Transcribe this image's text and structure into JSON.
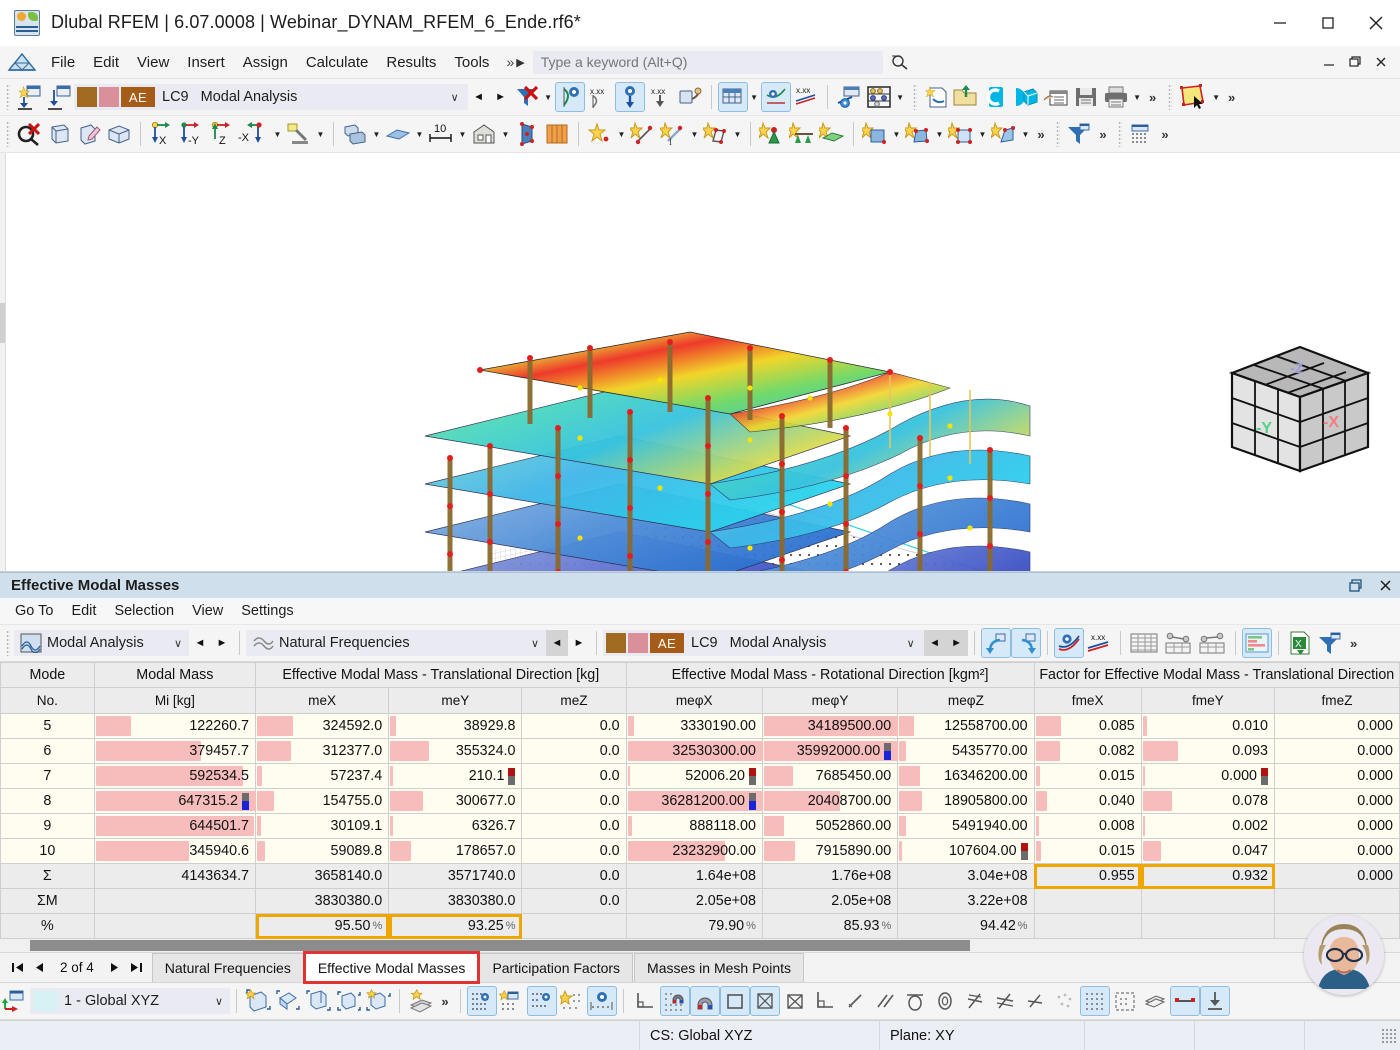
{
  "window": {
    "title": "Dlubal RFEM | 6.07.0008 | Webinar_DYNAM_RFEM_6_Ende.rf6*",
    "app_icon": "dlubal-logo-icon",
    "minimize": "minimize-icon",
    "maximize": "maximize-icon",
    "close": "close-icon"
  },
  "menu": {
    "items": [
      "File",
      "Edit",
      "View",
      "Insert",
      "Assign",
      "Calculate",
      "Results",
      "Tools"
    ],
    "overflow": "»",
    "play": "▶",
    "search_placeholder": "Type a keyword (Alt+Q)",
    "search_value": "",
    "search_icon": "search-icon"
  },
  "toolbar_loadcase": {
    "swatch_a": "#a06a20",
    "swatch_b": "#d9909a",
    "badge": "AE",
    "code": "LC9",
    "name": "Modal Analysis",
    "prev": "◄",
    "next": "►",
    "chevron": "∨"
  },
  "viewport": {
    "axes": {
      "x": "X",
      "y": "Y",
      "z": "Z"
    },
    "navcube": {
      "front_face": "-Y",
      "right_face": "-X",
      "top_face": "-Z"
    }
  },
  "panel": {
    "title": "Effective Modal Masses",
    "restore_icon": "restore-panel-icon",
    "close_icon": "close-panel-icon",
    "menu": [
      "Go To",
      "Edit",
      "Selection",
      "View",
      "Settings"
    ],
    "combo_analysis": {
      "icon": "modal-analysis-icon",
      "value": "Modal Analysis"
    },
    "combo_result": {
      "icon": "natural-frequencies-icon",
      "value": "Natural Frequencies"
    },
    "combo_loadcase": {
      "swatch_a": "#a06a20",
      "swatch_b": "#d9909a",
      "badge": "AE",
      "code": "LC9",
      "value": "Modal Analysis"
    }
  },
  "table": {
    "group_headers": [
      {
        "label": "Mode",
        "span": 1
      },
      {
        "label": "Modal Mass",
        "span": 1
      },
      {
        "label": "Effective Modal Mass - Translational Direction [kg]",
        "span": 3
      },
      {
        "label": "Effective Modal Mass - Rotational Direction [kgm²]",
        "span": 3
      },
      {
        "label": "Factor for Effective Modal Mass - Translational Direction",
        "span": 3
      }
    ],
    "sub_headers": [
      "No.",
      "Mi [kg]",
      "meX",
      "meY",
      "meZ",
      "meφX",
      "meφY",
      "meφZ",
      "fmeX",
      "fmeY",
      "fmeZ"
    ],
    "rows": [
      {
        "mode": "5",
        "cells": [
          {
            "value": "122260.7",
            "bar": 22,
            "flags": []
          },
          {
            "value": "324592.0",
            "bar": 27,
            "flags": []
          },
          {
            "value": "38929.8",
            "bar": 4,
            "flags": []
          },
          {
            "value": "0.0",
            "bar": 0,
            "flags": []
          },
          {
            "value": "3330190.00",
            "bar": 5,
            "flags": []
          },
          {
            "value": "34189500.00",
            "bar": 100,
            "flags": []
          },
          {
            "value": "12558700.00",
            "bar": 11,
            "flags": []
          },
          {
            "value": "0.085",
            "bar": 24,
            "flags": []
          },
          {
            "value": "0.010",
            "bar": 3,
            "flags": []
          },
          {
            "value": "0.000",
            "bar": 0,
            "flags": []
          }
        ]
      },
      {
        "mode": "6",
        "cells": [
          {
            "value": "379457.7",
            "bar": 66,
            "flags": []
          },
          {
            "value": "312377.0",
            "bar": 26,
            "flags": []
          },
          {
            "value": "355324.0",
            "bar": 29,
            "flags": []
          },
          {
            "value": "0.0",
            "bar": 0,
            "flags": []
          },
          {
            "value": "32530300.00",
            "bar": 100,
            "flags": []
          },
          {
            "value": "35992000.00",
            "bar": 100,
            "flags": [
              "gray",
              "blue"
            ]
          },
          {
            "value": "5435770.00",
            "bar": 5,
            "flags": []
          },
          {
            "value": "0.082",
            "bar": 23,
            "flags": []
          },
          {
            "value": "0.093",
            "bar": 27,
            "flags": []
          },
          {
            "value": "0.000",
            "bar": 0,
            "flags": []
          }
        ]
      },
      {
        "mode": "7",
        "cells": [
          {
            "value": "592534.5",
            "bar": 92,
            "flags": []
          },
          {
            "value": "57237.4",
            "bar": 4,
            "flags": []
          },
          {
            "value": "210.1",
            "bar": 2,
            "flags": [
              "red",
              "gray"
            ]
          },
          {
            "value": "0.0",
            "bar": 0,
            "flags": []
          },
          {
            "value": "52006.20",
            "bar": 2,
            "flags": [
              "red",
              "gray"
            ]
          },
          {
            "value": "7685450.00",
            "bar": 22,
            "flags": []
          },
          {
            "value": "16346200.00",
            "bar": 15,
            "flags": []
          },
          {
            "value": "0.015",
            "bar": 4,
            "flags": []
          },
          {
            "value": "0.000",
            "bar": 2,
            "flags": [
              "red",
              "gray"
            ]
          },
          {
            "value": "0.000",
            "bar": 0,
            "flags": []
          }
        ]
      },
      {
        "mode": "8",
        "cells": [
          {
            "value": "647315.2",
            "bar": 100,
            "flags": [
              "gray",
              "blue"
            ]
          },
          {
            "value": "154755.0",
            "bar": 13,
            "flags": []
          },
          {
            "value": "300677.0",
            "bar": 25,
            "flags": []
          },
          {
            "value": "0.0",
            "bar": 0,
            "flags": []
          },
          {
            "value": "36281200.00",
            "bar": 100,
            "flags": [
              "gray",
              "blue"
            ]
          },
          {
            "value": "20408700.00",
            "bar": 57,
            "flags": []
          },
          {
            "value": "18905800.00",
            "bar": 17,
            "flags": []
          },
          {
            "value": "0.040",
            "bar": 11,
            "flags": []
          },
          {
            "value": "0.078",
            "bar": 22,
            "flags": []
          },
          {
            "value": "0.000",
            "bar": 0,
            "flags": []
          }
        ]
      },
      {
        "mode": "9",
        "cells": [
          {
            "value": "644501.7",
            "bar": 99,
            "flags": []
          },
          {
            "value": "30109.1",
            "bar": 3,
            "flags": []
          },
          {
            "value": "6326.7",
            "bar": 2,
            "flags": []
          },
          {
            "value": "0.0",
            "bar": 0,
            "flags": []
          },
          {
            "value": "888118.00",
            "bar": 3,
            "flags": []
          },
          {
            "value": "5052860.00",
            "bar": 15,
            "flags": []
          },
          {
            "value": "5491940.00",
            "bar": 5,
            "flags": []
          },
          {
            "value": "0.008",
            "bar": 3,
            "flags": []
          },
          {
            "value": "0.002",
            "bar": 2,
            "flags": []
          },
          {
            "value": "0.000",
            "bar": 0,
            "flags": []
          }
        ]
      },
      {
        "mode": "10",
        "cells": [
          {
            "value": "345940.6",
            "bar": 58,
            "flags": []
          },
          {
            "value": "59089.8",
            "bar": 6,
            "flags": []
          },
          {
            "value": "178657.0",
            "bar": 16,
            "flags": []
          },
          {
            "value": "0.0",
            "bar": 0,
            "flags": []
          },
          {
            "value": "23232900.00",
            "bar": 72,
            "flags": []
          },
          {
            "value": "7915890.00",
            "bar": 23,
            "flags": []
          },
          {
            "value": "107604.00",
            "bar": 2,
            "flags": [
              "red",
              "gray"
            ]
          },
          {
            "value": "0.015",
            "bar": 5,
            "flags": []
          },
          {
            "value": "0.047",
            "bar": 14,
            "flags": []
          },
          {
            "value": "0.000",
            "bar": 0,
            "flags": []
          }
        ]
      }
    ],
    "sum_row": {
      "label": "Σ",
      "cells": [
        "4143634.7",
        "3658140.0",
        "3571740.0",
        "0.0",
        "1.64e+08",
        "1.76e+08",
        "3.04e+08",
        "0.955",
        "0.932",
        "0.000"
      ]
    },
    "summ_row": {
      "label": "ΣM",
      "cells": [
        "",
        "3830380.0",
        "3830380.0",
        "0.0",
        "2.05e+08",
        "2.05e+08",
        "3.22e+08",
        "",
        "",
        ""
      ]
    },
    "pct_row": {
      "label": "%",
      "unit": "%",
      "cells": [
        "",
        "95.50",
        "93.25",
        "",
        "79.90",
        "85.93",
        "94.42",
        "",
        "",
        ""
      ]
    },
    "highlight_color": "#f0a500"
  },
  "tabbar": {
    "first": "⏮",
    "prev": "◄",
    "page_text": "2 of 4",
    "next": "►",
    "last": "⏭",
    "tabs": [
      {
        "label": "Natural Frequencies",
        "selected": false
      },
      {
        "label": "Effective Modal Masses",
        "selected": true
      },
      {
        "label": "Participation Factors",
        "selected": false
      },
      {
        "label": "Masses in Mesh Points",
        "selected": false
      }
    ],
    "highlight_color": "#e23333"
  },
  "bottom_toolbar": {
    "cs_icon": "coordinate-system-icon",
    "cs_value": "1 - Global XYZ",
    "chevron": "∨",
    "overflow": "»"
  },
  "statusbar": {
    "cs": "CS: Global XYZ",
    "plane": "Plane: XY"
  }
}
